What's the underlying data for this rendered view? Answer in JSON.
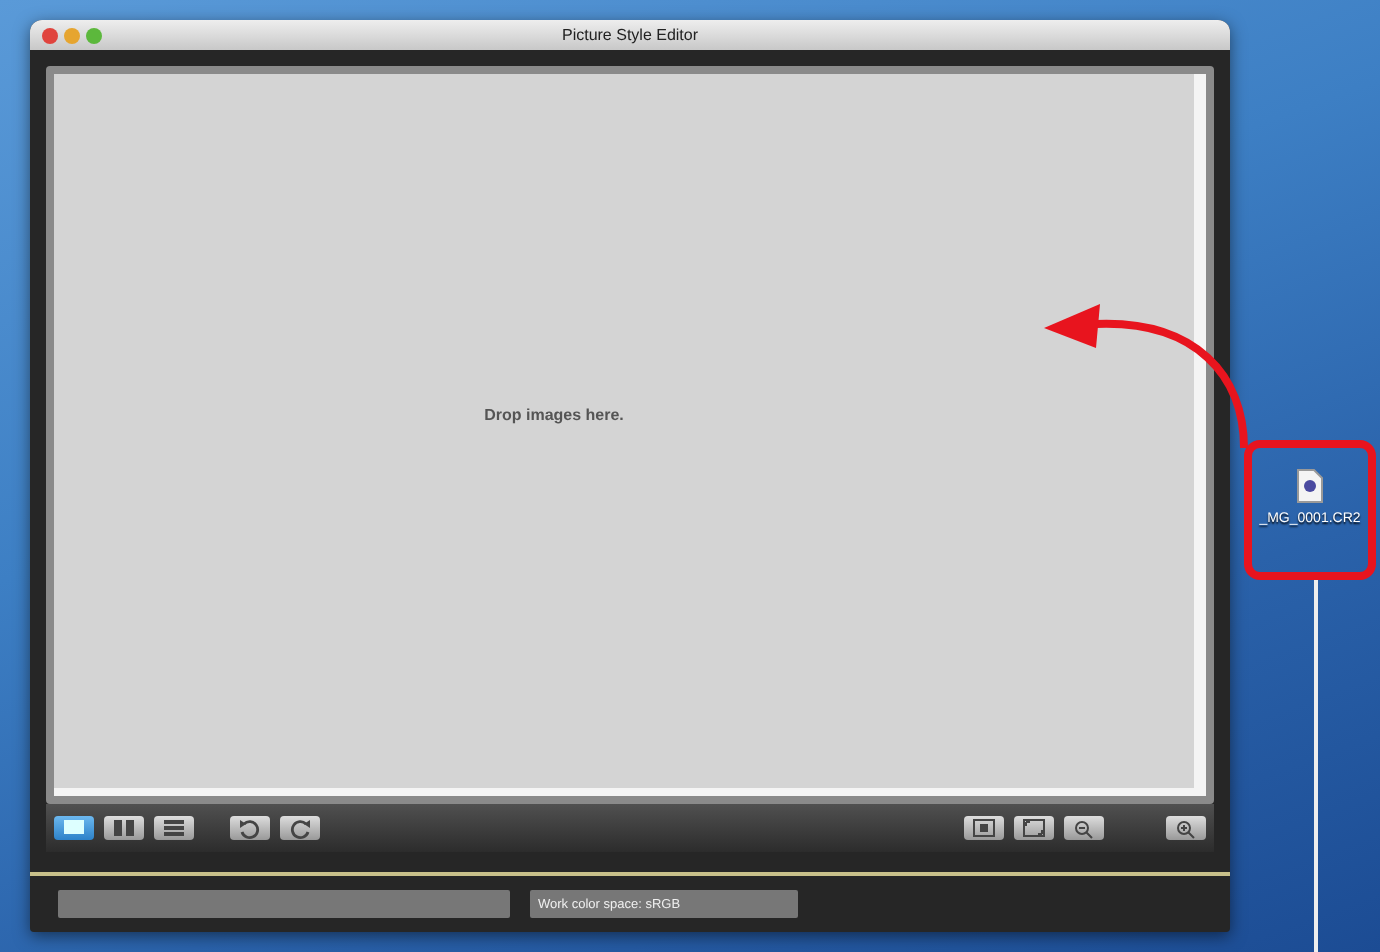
{
  "window": {
    "title": "Picture Style Editor"
  },
  "drop_area": {
    "message": "Drop images here."
  },
  "toolbar": {
    "view_buttons": [
      {
        "kind": "single",
        "selected": true
      },
      {
        "kind": "split",
        "selected": false
      },
      {
        "kind": "list",
        "selected": false
      }
    ],
    "rotate_buttons": [
      {
        "kind": "rotate-left"
      },
      {
        "kind": "rotate-right"
      }
    ],
    "zoom_buttons": [
      {
        "kind": "actual"
      },
      {
        "kind": "fit"
      },
      {
        "kind": "zoom-out"
      },
      {
        "kind": "zoom-in"
      }
    ]
  },
  "status_bar": {
    "work_color_space": "Work color space: sRGB"
  },
  "desktop": {
    "file_icon": {
      "label": "_MG_0001.CR2"
    }
  }
}
